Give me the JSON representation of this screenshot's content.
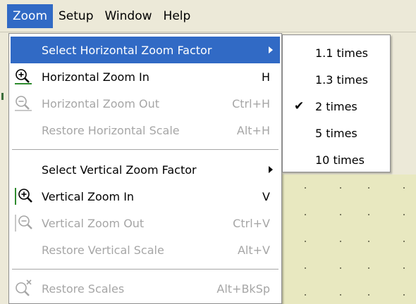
{
  "menubar": {
    "items": [
      "Zoom",
      "Setup",
      "Window",
      "Help"
    ],
    "active_index": 0
  },
  "zoom_menu": {
    "items": [
      {
        "label": "Select Horizontal Zoom Factor",
        "shortcut": "",
        "has_submenu": true,
        "enabled": true,
        "highlighted": true,
        "icon": ""
      },
      {
        "label": "Horizontal Zoom In",
        "shortcut": "H",
        "enabled": true,
        "icon": "horizontal-zoom-in-icon"
      },
      {
        "label": "Horizontal Zoom Out",
        "shortcut": "Ctrl+H",
        "enabled": false,
        "icon": "horizontal-zoom-out-icon"
      },
      {
        "label": "Restore Horizontal Scale",
        "shortcut": "Alt+H",
        "enabled": false,
        "icon": ""
      },
      {
        "label": "Select Vertical Zoom Factor",
        "shortcut": "",
        "has_submenu": true,
        "enabled": true,
        "icon": ""
      },
      {
        "label": "Vertical Zoom In",
        "shortcut": "V",
        "enabled": true,
        "icon": "vertical-zoom-in-icon"
      },
      {
        "label": "Vertical Zoom Out",
        "shortcut": "Ctrl+V",
        "enabled": false,
        "icon": "vertical-zoom-out-icon"
      },
      {
        "label": "Restore Vertical Scale",
        "shortcut": "Alt+V",
        "enabled": false,
        "icon": ""
      },
      {
        "label": "Restore Scales",
        "shortcut": "Alt+BkSp",
        "enabled": false,
        "icon": "restore-scales-icon"
      }
    ]
  },
  "horizontal_zoom_submenu": {
    "items": [
      {
        "label": "1.1 times",
        "checked": false
      },
      {
        "label": "1.3 times",
        "checked": false
      },
      {
        "label": "2 times",
        "checked": true
      },
      {
        "label": "5 times",
        "checked": false
      },
      {
        "label": "10 times",
        "checked": false
      }
    ],
    "check_glyph": "✔"
  },
  "colors": {
    "highlight": "#316ac5",
    "disabled_text": "#a6a6a6",
    "canvas_bg": "#e8e8c0",
    "icon_green": "#2e8b2e"
  }
}
